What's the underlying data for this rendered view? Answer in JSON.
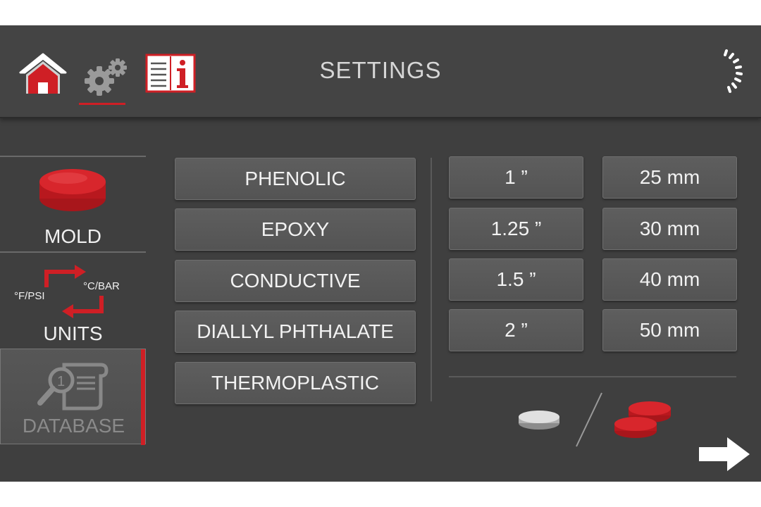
{
  "header": {
    "title": "SETTINGS",
    "icons": [
      "home-icon",
      "gear-icon",
      "info-manual-icon",
      "power-loading-icon"
    ]
  },
  "sidebar": {
    "items": [
      {
        "label": "MOLD",
        "icon": "mold-disc-icon"
      },
      {
        "label": "UNITS",
        "icon": "units-swap-icon",
        "left_unit": "°F/PSI",
        "right_unit": "°C/BAR"
      },
      {
        "label": "DATABASE",
        "icon": "database-search-icon",
        "active": true
      }
    ]
  },
  "materials": [
    "PHENOLIC",
    "EPOXY",
    "CONDUCTIVE",
    "DIALLYL PHTHALATE",
    "THERMOPLASTIC"
  ],
  "sizes_inch": [
    "1 ”",
    "1.25 ”",
    "1.5 ”",
    "2 ”"
  ],
  "sizes_mm": [
    "25 mm",
    "30 mm",
    "40 mm",
    "50 mm"
  ],
  "colors": {
    "accent": "#cf1f25",
    "background": "#3f3f3f",
    "button": "#5a5a5a",
    "text": "#f2f2f2"
  },
  "footer": {
    "next_icon": "arrow-right-icon"
  }
}
